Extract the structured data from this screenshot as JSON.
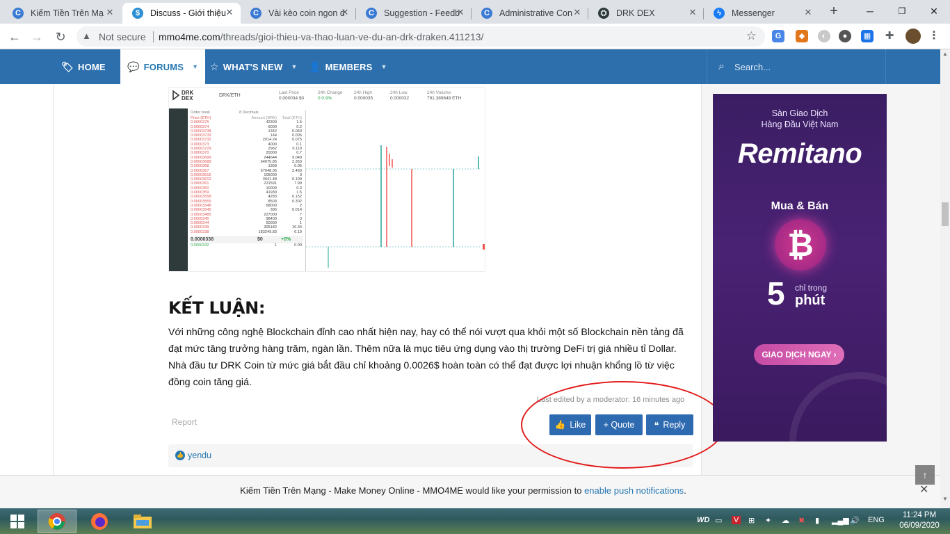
{
  "browser": {
    "tabs": [
      {
        "title": "Kiếm Tiền Trên Mạ",
        "icon": "mmo4me-icon",
        "active": false
      },
      {
        "title": "Discuss - Giới thiệu",
        "icon": "mmo4me-icon",
        "active": true
      },
      {
        "title": "Vài kèo coin ngon d",
        "icon": "mmo4me-icon",
        "active": false
      },
      {
        "title": "Suggestion - Feedb",
        "icon": "mmo4me-icon",
        "active": false
      },
      {
        "title": "Administrative Con",
        "icon": "mmo4me-icon",
        "active": false
      },
      {
        "title": "DRK DEX",
        "icon": "drk-dex-icon",
        "active": false
      },
      {
        "title": "Messenger",
        "icon": "messenger-icon",
        "active": false
      }
    ],
    "new_tab": "+",
    "address": {
      "security": "Not secure",
      "domain": "mmo4me.com",
      "path": "/threads/gioi-thieu-va-thao-luan-ve-du-an-drk-draken.411213/"
    }
  },
  "site_nav": {
    "items": [
      {
        "label": "HOME",
        "icon": "tag-icon"
      },
      {
        "label": "FORUMS",
        "icon": "comments-icon"
      },
      {
        "label": "WHAT'S NEW",
        "icon": "star-icon"
      },
      {
        "label": "MEMBERS",
        "icon": "user-icon"
      }
    ],
    "search_placeholder": "Search..."
  },
  "dex": {
    "logo": "DRK\nDEX",
    "pair": "DRK/ETH",
    "stats": [
      {
        "label": "Last Price",
        "value": "0.000034  $0"
      },
      {
        "label": "24h Change",
        "value": "0   0.9%"
      },
      {
        "label": "24h High",
        "value": "0.000035"
      },
      {
        "label": "24h Low",
        "value": "0.000032"
      },
      {
        "label": "24h Volume",
        "value": "791.389649 ETH"
      }
    ],
    "orderbook_title": "Order book",
    "orderbook_decimals": "8 Decimals",
    "orderbook_headers": [
      "Price (ETH)",
      "Amount (DRK)",
      "Total (ETH)"
    ],
    "orderbook_rows": [
      [
        "0.0000375",
        "42300",
        "1.5"
      ],
      [
        "0.0000374",
        "6000",
        "0.2"
      ],
      [
        "0.00003738",
        "1342",
        "0.050"
      ],
      [
        "0.00003733",
        "144",
        "0.005"
      ],
      [
        "0.00003732",
        "2014.24",
        "0.075"
      ],
      [
        "0.0000373",
        "4000",
        "0.1"
      ],
      [
        "0.00003729",
        "2962",
        "0.110"
      ],
      [
        "0.0000370",
        "20000",
        "0.7"
      ],
      [
        "0.00003699",
        "244644",
        "9.049"
      ],
      [
        "0.00003689",
        "64075.85",
        "2.363"
      ],
      [
        "0.0000368",
        "1368",
        "0.05"
      ],
      [
        "0.0000367",
        "67048.06",
        "2.460"
      ],
      [
        "0.00003615",
        "105000",
        "3"
      ],
      [
        "0.00003612",
        "3041.48",
        "0.109"
      ],
      [
        "0.0000361",
        "221591",
        "7.99"
      ],
      [
        "0.0000360",
        "10000",
        "0.3"
      ],
      [
        "0.0000359",
        "41930",
        "1.5"
      ],
      [
        "0.00003558",
        "4283",
        "0.152"
      ],
      [
        "0.00003555",
        "8503",
        "0.302"
      ],
      [
        "0.00003548",
        "68000",
        "2"
      ],
      [
        "0.00003545",
        "395",
        "0.014"
      ],
      [
        "0.00003485",
        "227000",
        "7"
      ],
      [
        "0.0000345",
        "98400",
        "3"
      ],
      [
        "0.0000344",
        "50000",
        "1"
      ],
      [
        "0.0000339",
        "305182",
        "10.34"
      ],
      [
        "0.0000338",
        "183249.83",
        "6.19"
      ]
    ],
    "last_price": "0.0000338",
    "last_usd": "$0",
    "last_change": "+0%",
    "bid_row": [
      "0.0000332",
      "1",
      "0.00"
    ]
  },
  "article": {
    "heading": "KẾT LUẬN:",
    "body": "Với những công nghệ Blockchain đỉnh cao nhất hiện nay, hay có thể nói vượt qua khỏi một số Blockchain nền tảng đã đạt mức tăng trưởng hàng trăm, ngàn lần. Thêm nữa là mục tiêu ứng dụng vào thị trường DeFi trị giá nhiều tỉ Dollar. Nhà đầu tư DRK Coin từ mức giá bắt đầu chỉ khoảng 0.0026$ hoàn toàn có thể đạt được lợi nhuận khổng lồ từ việc đồng coin tăng giá.",
    "edited": "Last edited by a moderator: 16 minutes ago",
    "report": "Report",
    "actions": {
      "like": "Like",
      "quote": "+ Quote",
      "reply": "Reply"
    },
    "reaction_user": "yendu"
  },
  "ad": {
    "tagline": "Sàn Giao Dịch\nHàng Đầu Việt Nam",
    "brand": "Remitano",
    "buy_sell": "Mua & Bán",
    "coin_symbol": "₿",
    "number": "5",
    "small": "chỉ trong",
    "unit": "phút",
    "cta": "GIAO DỊCH NGAY ›"
  },
  "notification": {
    "text": "Kiếm Tiền Trên Mạng - Make Money Online - MMO4ME would like your permission to ",
    "link": "enable push notifications",
    "suffix": "."
  },
  "taskbar": {
    "lang": "ENG",
    "time": "11:24 PM",
    "date": "06/09/2020"
  },
  "colors": {
    "nav_blue": "#2d6fad",
    "button_blue": "#2e6ab0",
    "annotation_red": "#e21a1a",
    "ad_purple": "#4a2274"
  }
}
